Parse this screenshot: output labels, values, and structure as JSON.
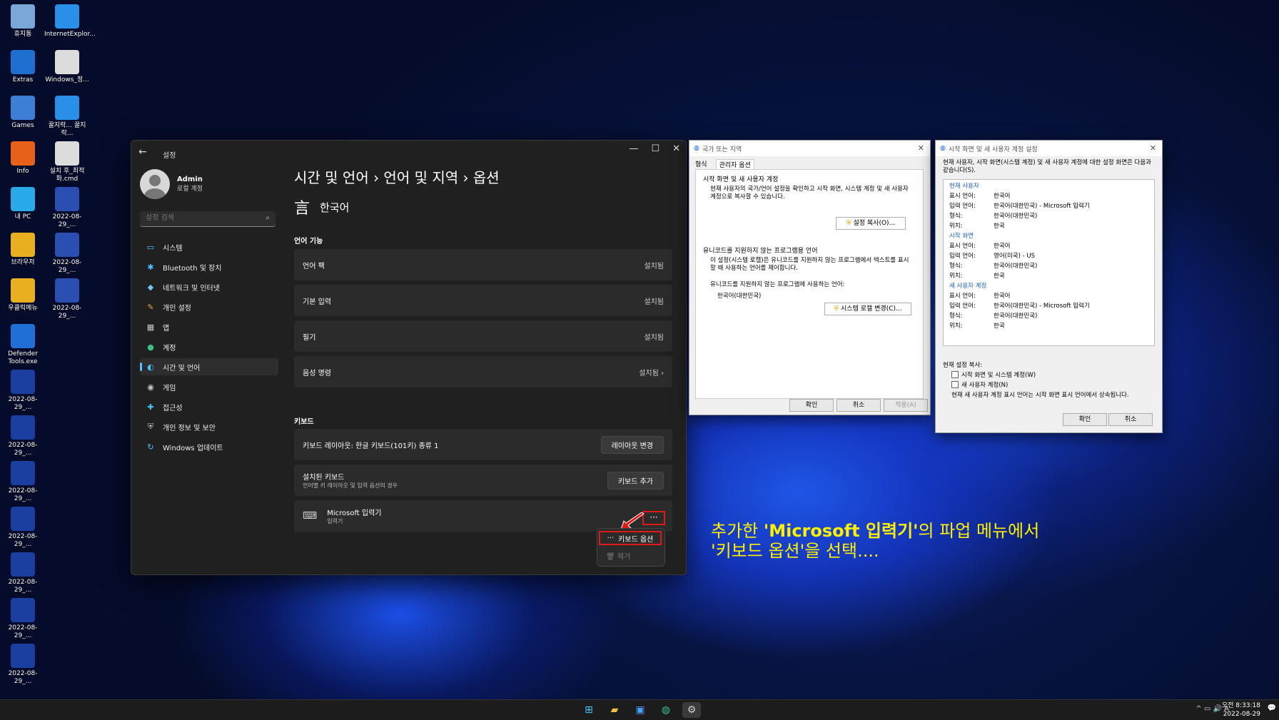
{
  "desktop": {
    "icons": [
      {
        "label": "휴지통",
        "color": "#7aa7d8"
      },
      {
        "label": "InternetExplor...",
        "color": "#2a8fe6"
      },
      {
        "label": "Extras",
        "color": "#1e6fd0"
      },
      {
        "label": "Windows_정...",
        "color": "#dcdcdc"
      },
      {
        "label": "Games",
        "color": "#3d7fd6"
      },
      {
        "label": "꿀지락... 꿀지락...",
        "color": "#2a8fe6"
      },
      {
        "label": "Info",
        "color": "#e8611a"
      },
      {
        "label": "설치 후_최적화.cmd",
        "color": "#dcdcdc"
      },
      {
        "label": "내 PC",
        "color": "#29a9e8"
      },
      {
        "label": "2022-08-29_...",
        "color": "#2b4fb0"
      },
      {
        "label": "브라우저",
        "color": "#e8b020"
      },
      {
        "label": "2022-08-29_...",
        "color": "#2b4fb0"
      },
      {
        "label": "우클릭메뉴",
        "color": "#e8b020"
      },
      {
        "label": "2022-08-29_...",
        "color": "#2b4fb0"
      },
      {
        "label": "Defender Tools.exe",
        "color": "#1f6fd6"
      },
      {
        "label": "2022-08-29_...",
        "color": "#1b3fa0"
      },
      {
        "label": "2022-08-29_...",
        "color": "#1b3fa0"
      },
      {
        "label": "2022-08-29_...",
        "color": "#1b3fa0"
      },
      {
        "label": "2022-08-29_...",
        "color": "#1b3fa0"
      },
      {
        "label": "2022-08-29_...",
        "color": "#1b3fa0"
      },
      {
        "label": "2022-08-29_...",
        "color": "#1b3fa0"
      },
      {
        "label": "2022-08-29_...",
        "color": "#1b3fa0"
      }
    ]
  },
  "settings": {
    "title": "설정",
    "back_icon": "←",
    "controls": {
      "minimize": "—",
      "maximize": "☐",
      "close": "✕"
    },
    "profile": {
      "name": "Admin",
      "account": "로컬 계정"
    },
    "search": {
      "placeholder": "설정 검색",
      "icon": "⌕"
    },
    "nav": [
      {
        "label": "시스템",
        "icon": "▭",
        "color": "#4cc2ff"
      },
      {
        "label": "Bluetooth 및 장치",
        "icon": "✱",
        "color": "#4cc2ff"
      },
      {
        "label": "네트워크 및 인터넷",
        "icon": "◆",
        "color": "#6fc3ff"
      },
      {
        "label": "개인 설정",
        "icon": "✎",
        "color": "#f0a050"
      },
      {
        "label": "앱",
        "icon": "▦",
        "color": "#c9c9c9"
      },
      {
        "label": "계정",
        "icon": "●",
        "color": "#40c080"
      },
      {
        "label": "시간 및 언어",
        "icon": "◐",
        "color": "#4cc2ff"
      },
      {
        "label": "게임",
        "icon": "◉",
        "color": "#c9c9c9"
      },
      {
        "label": "접근성",
        "icon": "✚",
        "color": "#4cc2ff"
      },
      {
        "label": "개인 정보 및 보안",
        "icon": "⛨",
        "color": "#c9c9c9"
      },
      {
        "label": "Windows 업데이트",
        "icon": "↻",
        "color": "#4cc2ff"
      }
    ],
    "breadcrumb": "시간 및 언어  ›  언어 및 지역  ›  옵션",
    "language": {
      "icon": "言",
      "name": "한국어"
    },
    "section_language_features": "언어 기능",
    "features": [
      {
        "label": "언어 팩",
        "status": "설치됨"
      },
      {
        "label": "기본 입력",
        "status": "설치됨"
      },
      {
        "label": "필기",
        "status": "설치됨"
      },
      {
        "label": "음성 명령",
        "status": "설치됨  ›"
      }
    ],
    "section_keyboard": "키보드",
    "keyboard_layout": {
      "label": "키보드 레이아웃: 한글 키보드(101키) 종류 1",
      "button": "레이아웃 변경"
    },
    "installed_keyboards": {
      "label": "설치된 키보드",
      "sub": "언어별 키 레이아웃 및 입력 옵션의 경우",
      "button": "키보드 추가"
    },
    "ime": {
      "name": "Microsoft 입력기",
      "sub": "입력기",
      "more": "···",
      "icon": "⌨"
    },
    "context_menu": {
      "item1_icon": "···",
      "item1": "키보드 옵션",
      "item2_icon": "🗑",
      "item2": "제거"
    }
  },
  "region_dialog": {
    "title": "국가 또는 지역",
    "tabs": [
      "형식",
      "관리자 옵션"
    ],
    "group1_title": "시작 화면 및 새 사용자 계정",
    "group1_text": "현재 사용자의 국가/언어 설정을 확인하고 시작 화면, 시스템 계정 및 새 사용자 계정으로 복사할 수 있습니다.",
    "group1_button": "설정 복사(O)...",
    "group2_title": "유니코드를 지원하지 않는 프로그램용 언어",
    "group2_text": "이 설정(시스템 로캘)은 유니코드를 지원하지 않는 프로그램에서 텍스트를 표시할 때 사용하는 언어를 제어합니다.",
    "group2_label": "유니코드를 지원하지 않는 프로그램에 사용하는 언어:",
    "group2_value": "한국어(대한민국)",
    "group2_button": "시스템 로캘 변경(C)...",
    "buttons": {
      "ok": "확인",
      "cancel": "취소",
      "apply": "적용(A)"
    }
  },
  "welcome_dialog": {
    "title": "시작 화면 및 새 사용자 계정 설정",
    "intro": "현재 사용자, 시작 화면(시스템 계정) 및 새 사용자 계정에 대한 설정 화면은 다음과 같습니다(S).",
    "sections": [
      {
        "head": "현재 사용자",
        "rows": [
          [
            "표시 언어:",
            "한국어"
          ],
          [
            "입력 언어:",
            "한국어(대한민국) - Microsoft 입력기"
          ],
          [
            "형식:",
            "한국어(대한민국)"
          ],
          [
            "위치:",
            "한국"
          ]
        ]
      },
      {
        "head": "시작 화면",
        "rows": [
          [
            "표시 언어:",
            "한국어"
          ],
          [
            "입력 언어:",
            "영어(미국) - US"
          ],
          [
            "형식:",
            "한국어(대한민국)"
          ],
          [
            "위치:",
            "한국"
          ]
        ]
      },
      {
        "head": "새 사용자 계정",
        "rows": [
          [
            "표시 언어:",
            "한국어"
          ],
          [
            "입력 언어:",
            "한국어(대한민국) - Microsoft 입력기"
          ],
          [
            "형식:",
            "한국어(대한민국)"
          ],
          [
            "위치:",
            "한국"
          ]
        ]
      }
    ],
    "copy_label": "현재 설정 복사:",
    "check1": "시작 화면 및 시스템 계정(W)",
    "check2": "새 사용자 계정(N)",
    "note": "현재 새 사용자 계정 표시 언어는 시작 화면 표시 언어에서 상속됩니다.",
    "buttons": {
      "ok": "확인",
      "cancel": "취소"
    }
  },
  "annotation": {
    "line1_pre": "추가한 ",
    "line1_bold": "'Microsoft 입력기'",
    "line1_post": "의 파업 메뉴에서",
    "line2": "'키보드 옵션'을 선택...."
  },
  "taskbar": {
    "apps": [
      {
        "name": "start",
        "icon": "⊞",
        "color": "#4cc2ff"
      },
      {
        "name": "explorer",
        "icon": "▰",
        "color": "#f2c040"
      },
      {
        "name": "store",
        "icon": "▣",
        "color": "#4aa0ff"
      },
      {
        "name": "edge",
        "icon": "◍",
        "color": "#3bbf9a"
      },
      {
        "name": "settings",
        "icon": "⚙",
        "color": "#cfcfcf"
      }
    ],
    "tray": "^  ▭  🔊  A",
    "time": "오전 8:33:18",
    "date": "2022-08-29",
    "notification": "💬"
  },
  "accent": "#4cc2ff",
  "highlight": "#e01818"
}
